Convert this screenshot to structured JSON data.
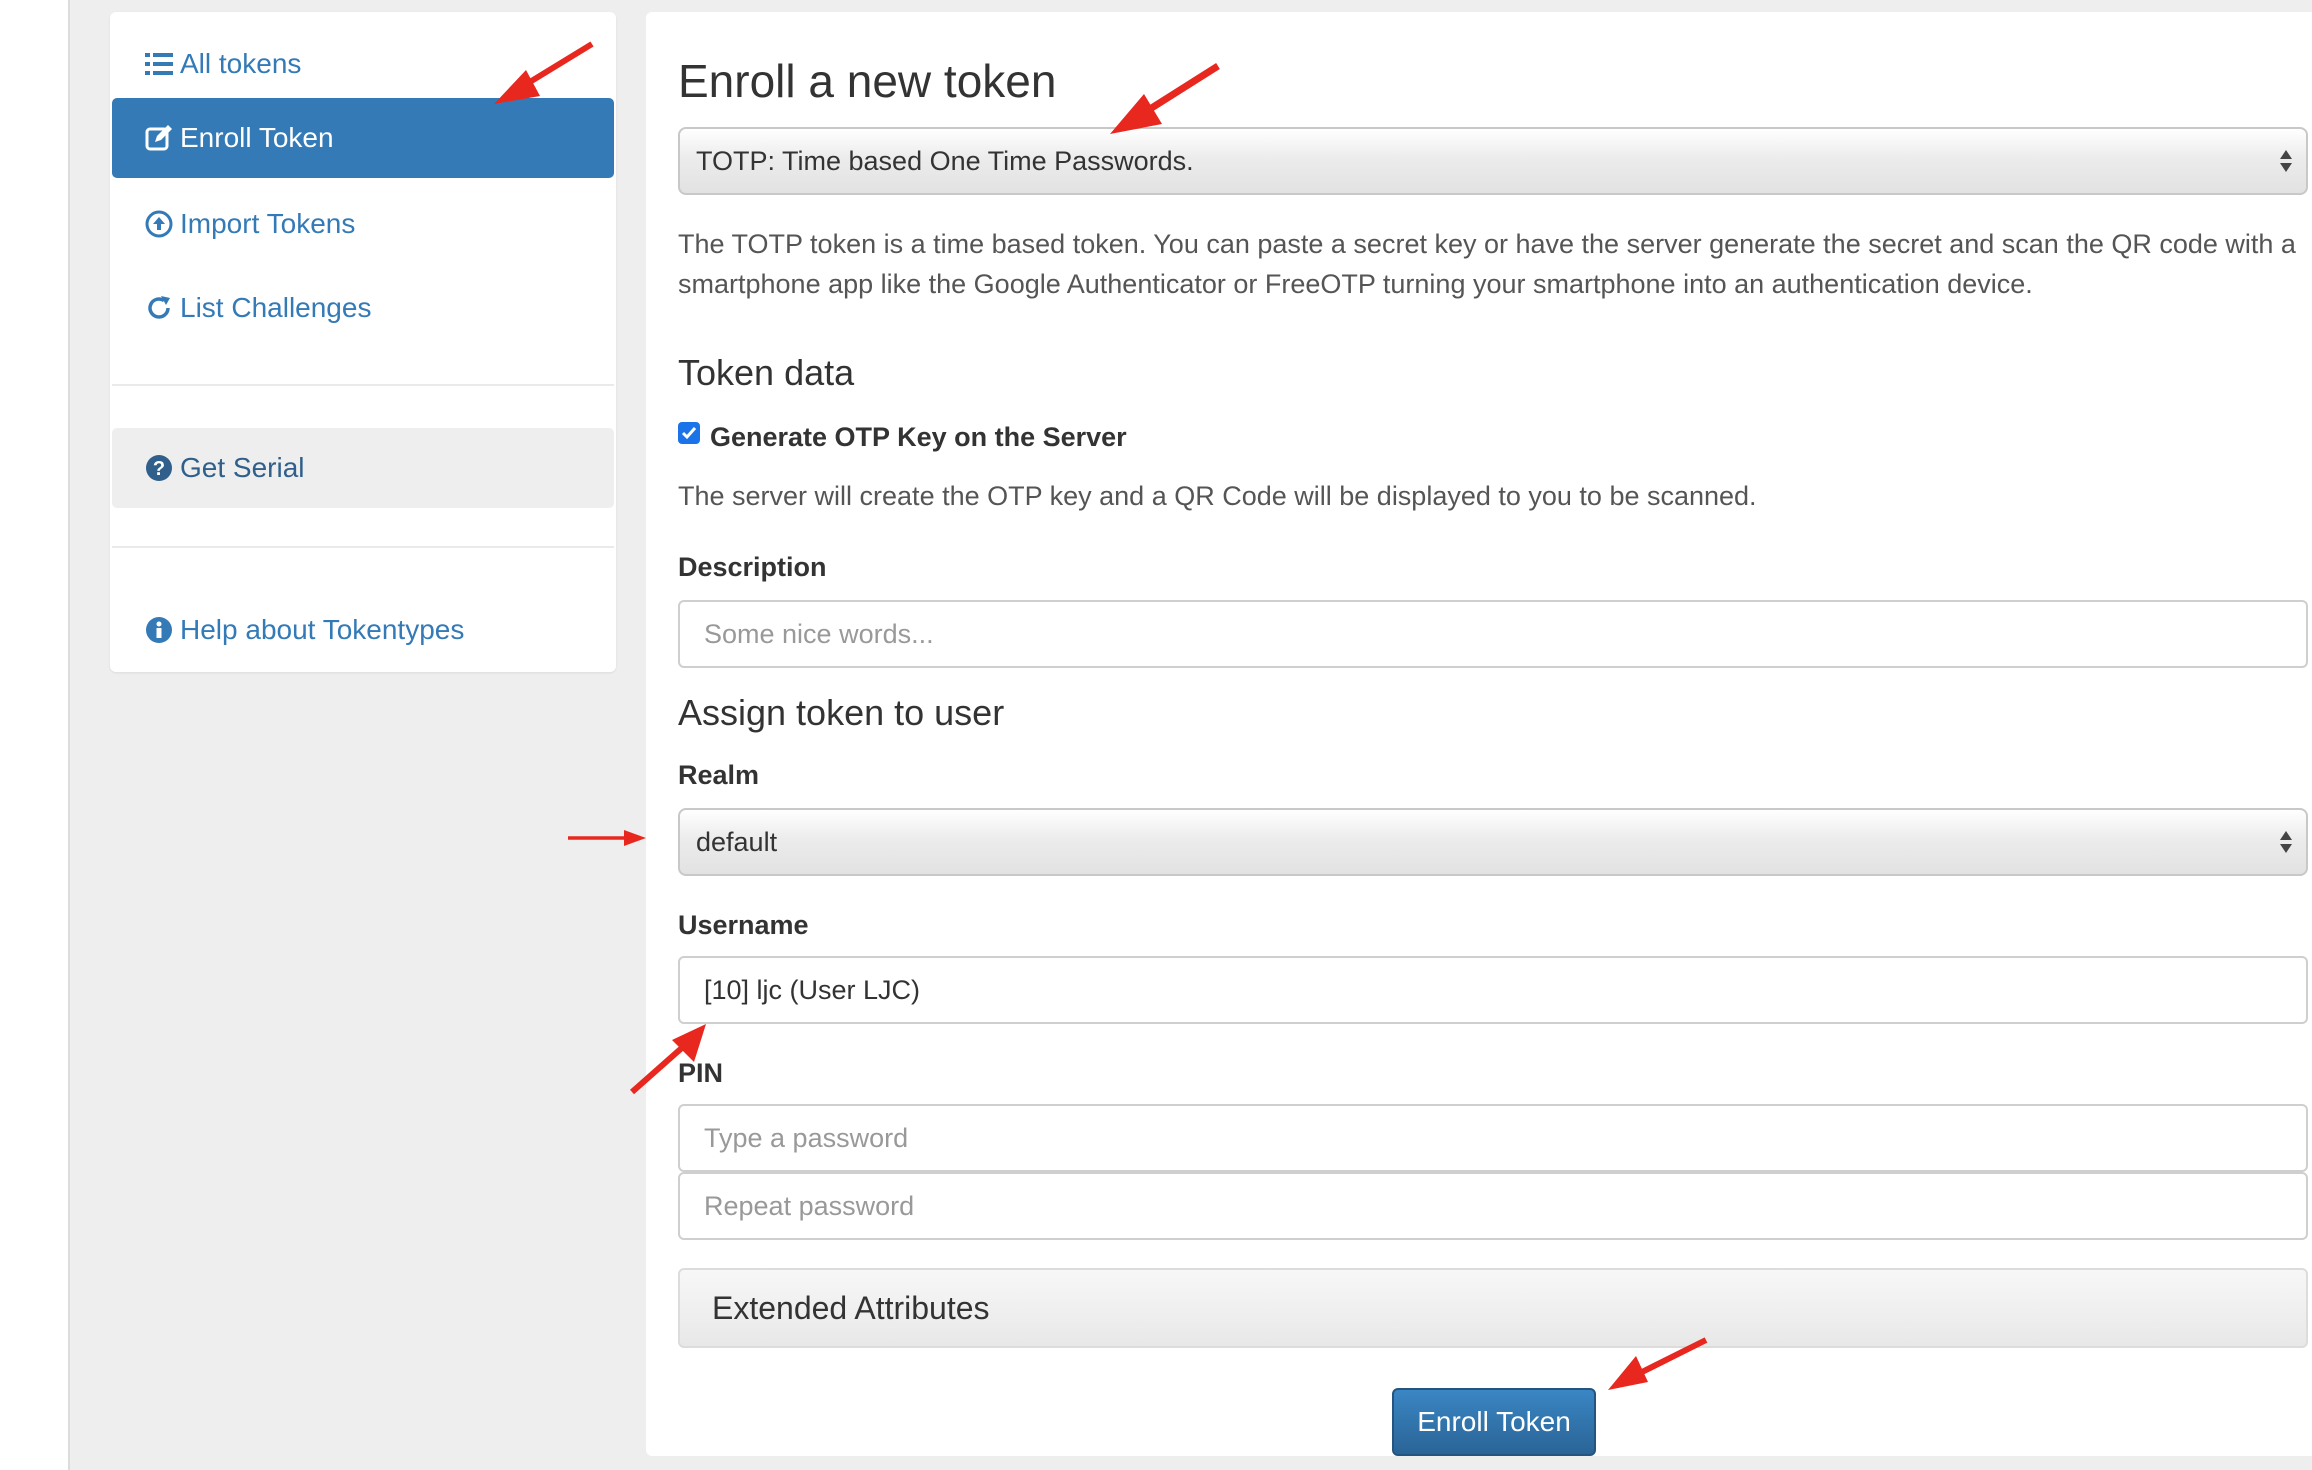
{
  "sidebar": {
    "items": [
      {
        "label": "All tokens",
        "icon": "list-icon",
        "state": "normal"
      },
      {
        "label": "Enroll Token",
        "icon": "edit-icon",
        "state": "active"
      },
      {
        "label": "Import Tokens",
        "icon": "upload-circle-icon",
        "state": "normal"
      },
      {
        "label": "List Challenges",
        "icon": "refresh-icon",
        "state": "normal"
      }
    ],
    "get_serial": {
      "label": "Get Serial",
      "icon": "question-circle-icon"
    },
    "help": {
      "label": "Help about Tokentypes",
      "icon": "info-circle-icon"
    }
  },
  "main": {
    "title": "Enroll a new token",
    "token_type_select": {
      "value": "TOTP: Time based One Time Passwords."
    },
    "description": "The TOTP token is a time based token. You can paste a secret key or have the server generate the secret and scan the QR code with a smartphone app like the Google Authenticator or FreeOTP turning your smartphone into an authentication device.",
    "token_data": {
      "heading": "Token data",
      "generate_checkbox": {
        "label": "Generate OTP Key on the Server",
        "checked": true
      },
      "generate_help": "The server will create the OTP key and a QR Code will be displayed to you to be scanned.",
      "description_label": "Description",
      "description_placeholder": "Some nice words..."
    },
    "assign": {
      "heading": "Assign token to user",
      "realm_label": "Realm",
      "realm_value": "default",
      "username_label": "Username",
      "username_value": "[10] ljc (User LJC)",
      "pin_label": "PIN",
      "pin_placeholder": "Type a password",
      "pin_repeat_placeholder": "Repeat password"
    },
    "extended_attributes": "Extended Attributes",
    "submit_label": "Enroll Token"
  },
  "colors": {
    "primary": "#337ab7",
    "annotation_arrow": "#e8281e",
    "checkbox": "#1a73e8"
  }
}
